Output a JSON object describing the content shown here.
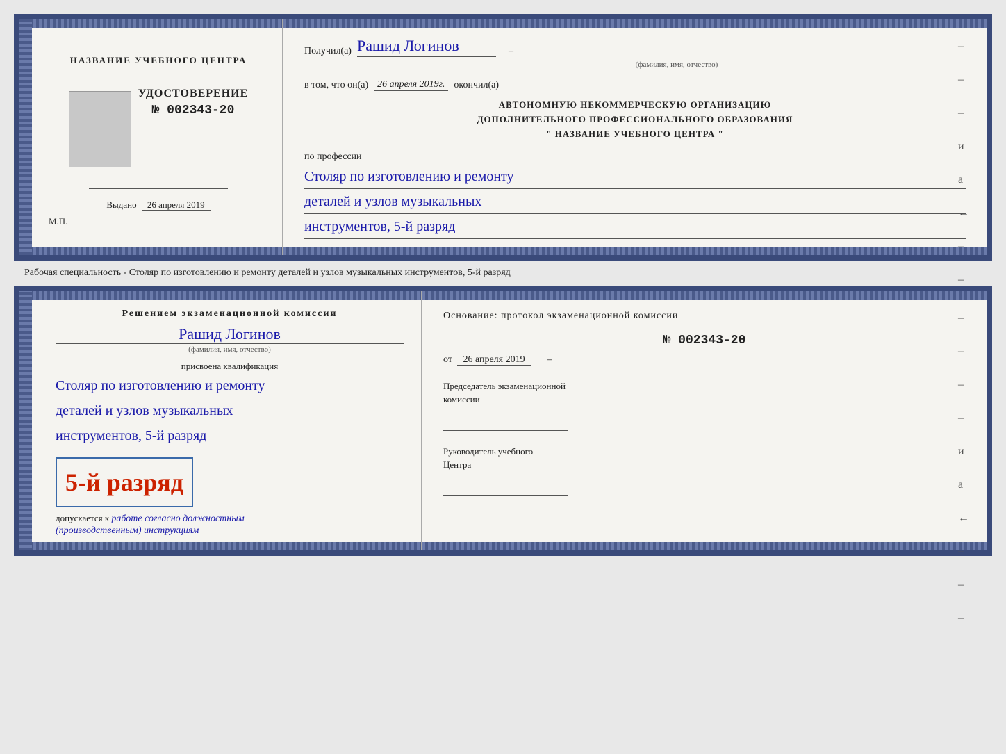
{
  "page": {
    "background_color": "#e8e8e8"
  },
  "top_doc": {
    "left": {
      "school_label": "НАЗВАНИЕ УЧЕБНОГО ЦЕНТРА",
      "cert_title": "УДОСТОВЕРЕНИЕ",
      "cert_number": "№ 002343-20",
      "vydano_label": "Выдано",
      "vydano_date": "26 апреля 2019",
      "mp_label": "М.П."
    },
    "right": {
      "poluchil_text": "Получил(а)",
      "recipient_name": "Рашид Логинов",
      "fio_label": "(фамилия, имя, отчество)",
      "v_tom_text": "в том, что он(а)",
      "date_value": "26 апреля 2019г.",
      "okonchill_text": "окончил(а)",
      "org_line1": "АВТОНОМНУЮ НЕКОММЕРЧЕСКУЮ ОРГАНИЗАЦИЮ",
      "org_line2": "ДОПОЛНИТЕЛЬНОГО ПРОФЕССИОНАЛЬНОГО ОБРАЗОВАНИЯ",
      "org_line3": "\"   НАЗВАНИЕ УЧЕБНОГО ЦЕНТРА   \"",
      "po_professii": "по профессии",
      "profession_line1": "Столяр по изготовлению и ремонту",
      "profession_line2": "деталей и узлов музыкальных",
      "profession_line3": "инструментов, 5-й разряд",
      "dash1": "–",
      "dash2": "–",
      "dash3": "–",
      "i_letter": "и",
      "a_letter": "а",
      "arrow": "←"
    }
  },
  "separator": {
    "text": "Рабочая специальность - Столяр по изготовлению и ремонту деталей и узлов музыкальных инструментов, 5-й разряд"
  },
  "bottom_doc": {
    "left": {
      "resheniem_title": "Решением  экзаменационной  комиссии",
      "recipient_name": "Рашид Логинов",
      "fio_label": "(фамилия, имя, отчество)",
      "prisvoena_label": "присвоена квалификация",
      "qual_line1": "Столяр по изготовлению и ремонту",
      "qual_line2": "деталей и узлов музыкальных",
      "qual_line3": "инструментов, 5-й разряд",
      "big_rank": "5-й разряд",
      "dopuskaetsya_prefix": "допускается к",
      "dopuskaetsya_text": "работе согласно должностным",
      "dopuskaetsya_text2": "(производственным) инструкциям"
    },
    "right": {
      "osnovanie_text": "Основание: протокол экзаменационной комиссии",
      "protocol_number": "№  002343-20",
      "ot_label": "от",
      "ot_date": "26 апреля 2019",
      "predsedatel_label": "Председатель экзаменационной",
      "predsedatel_label2": "комиссии",
      "rukovoditel_label": "Руководитель учебного",
      "rukovoditel_label2": "Центра",
      "dash1": "–",
      "dash2": "–",
      "dash3": "–",
      "dash4": "–",
      "i_letter": "и",
      "a_letter": "а",
      "arrow": "←",
      "dash5": "–",
      "dash6": "–",
      "dash7": "–"
    }
  }
}
